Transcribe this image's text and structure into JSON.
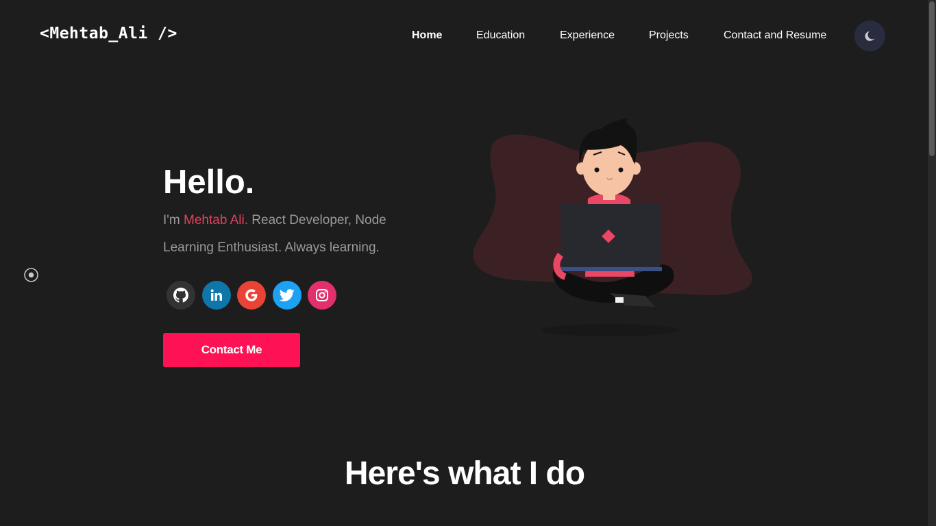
{
  "header": {
    "logo": "<Mehtab_Ali />",
    "nav": [
      {
        "label": "Home",
        "active": true
      },
      {
        "label": "Education",
        "active": false
      },
      {
        "label": "Experience",
        "active": false
      },
      {
        "label": "Projects",
        "active": false
      },
      {
        "label": "Contact and Resume",
        "active": false
      }
    ],
    "theme_toggle_icon": "moon-icon"
  },
  "hero": {
    "title": "Hello.",
    "intro_prefix": "I'm ",
    "name": "Mehtab Ali.",
    "intro_rest": " React Developer, Node Learning Enthusiast. Always learning.",
    "socials": [
      {
        "icon": "github-icon",
        "color": "#333333"
      },
      {
        "icon": "linkedin-icon",
        "color": "#0e76a8"
      },
      {
        "icon": "google-icon",
        "color": "#ea4335"
      },
      {
        "icon": "twitter-icon",
        "color": "#1da1f2"
      },
      {
        "icon": "instagram-icon",
        "color": "#e1306c"
      }
    ],
    "contact_button": "Contact Me"
  },
  "section": {
    "title": "Here's what I do"
  },
  "colors": {
    "background": "#1d1d1d",
    "accent": "#fe1255",
    "name_highlight": "#e3405f",
    "muted_text": "#9a9a9a",
    "blob": "#3b2024"
  }
}
